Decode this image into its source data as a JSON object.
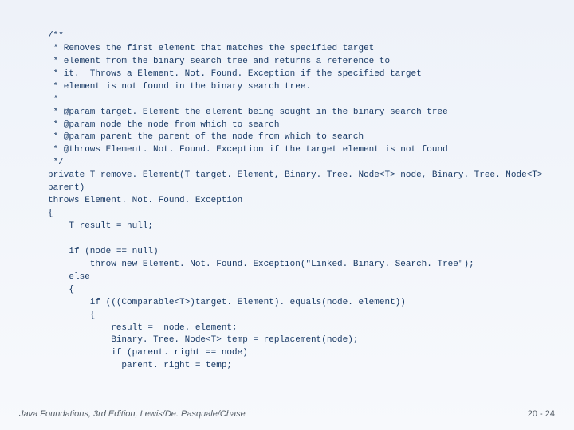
{
  "code": {
    "l1": "/**",
    "l2": " * Removes the first element that matches the specified target",
    "l3": " * element from the binary search tree and returns a reference to",
    "l4": " * it.  Throws a Element. Not. Found. Exception if the specified target",
    "l5": " * element is not found in the binary search tree.",
    "l6": " *",
    "l7": " * @param target. Element the element being sought in the binary search tree",
    "l8": " * @param node the node from which to search",
    "l9": " * @param parent the parent of the node from which to search",
    "l10": " * @throws Element. Not. Found. Exception if the target element is not found",
    "l11": " */",
    "l12": "private T remove. Element(T target. Element, Binary. Tree. Node<T> node, Binary. Tree. Node<T>",
    "l13": "parent)",
    "l14": "throws Element. Not. Found. Exception",
    "l15": "{",
    "l16": "    T result = null;",
    "l17": "",
    "l18": "    if (node == null)",
    "l19": "        throw new Element. Not. Found. Exception(\"Linked. Binary. Search. Tree\");",
    "l20": "    else",
    "l21": "    {",
    "l22": "        if (((Comparable<T>)target. Element). equals(node. element))",
    "l23": "        {",
    "l24": "            result =  node. element;",
    "l25": "            Binary. Tree. Node<T> temp = replacement(node);",
    "l26": "            if (parent. right == node)",
    "l27": "              parent. right = temp;"
  },
  "footer": {
    "left": "Java Foundations, 3rd Edition, Lewis/De. Pasquale/Chase",
    "right": "20 - 24"
  }
}
